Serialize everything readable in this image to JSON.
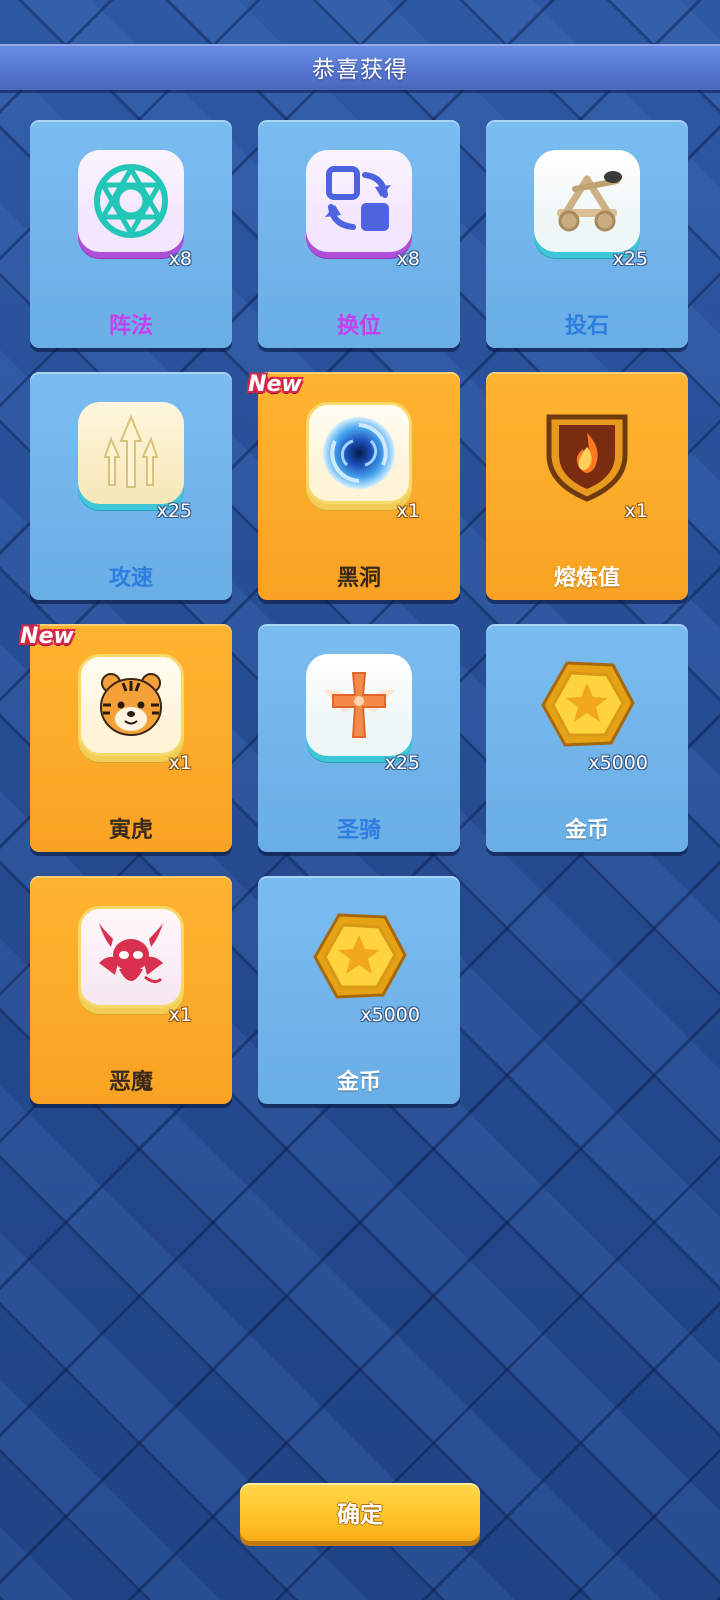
{
  "title": "恭喜获得",
  "rewards": [
    {
      "name": "阵法",
      "qty": "x8",
      "icon": "formation-icon",
      "style": "blue"
    },
    {
      "name": "换位",
      "qty": "x8",
      "icon": "swap-icon",
      "style": "blue"
    },
    {
      "name": "投石",
      "qty": "x25",
      "icon": "catapult-icon",
      "style": "blue"
    },
    {
      "name": "攻速",
      "qty": "x25",
      "icon": "attack-speed-icon",
      "style": "blue"
    },
    {
      "name": "黑洞",
      "qty": "x1",
      "icon": "black-hole-icon",
      "style": "orange",
      "badge": "New"
    },
    {
      "name": "熔炼值",
      "qty": "x1",
      "icon": "smelting-shield-icon",
      "style": "orange"
    },
    {
      "name": "寅虎",
      "qty": "x1",
      "icon": "tiger-icon",
      "style": "orange",
      "badge": "New"
    },
    {
      "name": "圣骑",
      "qty": "x25",
      "icon": "holy-knight-cross-icon",
      "style": "blue"
    },
    {
      "name": "金币",
      "qty": "x5000",
      "icon": "gold-coin-icon",
      "style": "blue"
    },
    {
      "name": "恶魔",
      "qty": "x1",
      "icon": "demon-icon",
      "style": "orange"
    },
    {
      "name": "金币",
      "qty": "x5000",
      "icon": "gold-coin-icon",
      "style": "blue"
    }
  ],
  "confirm_label": "确定",
  "colors": {
    "card_blue": "#6aaee6",
    "card_orange": "#f9a223",
    "name_purple": "#c440ee",
    "name_blue": "#2e7de0"
  }
}
